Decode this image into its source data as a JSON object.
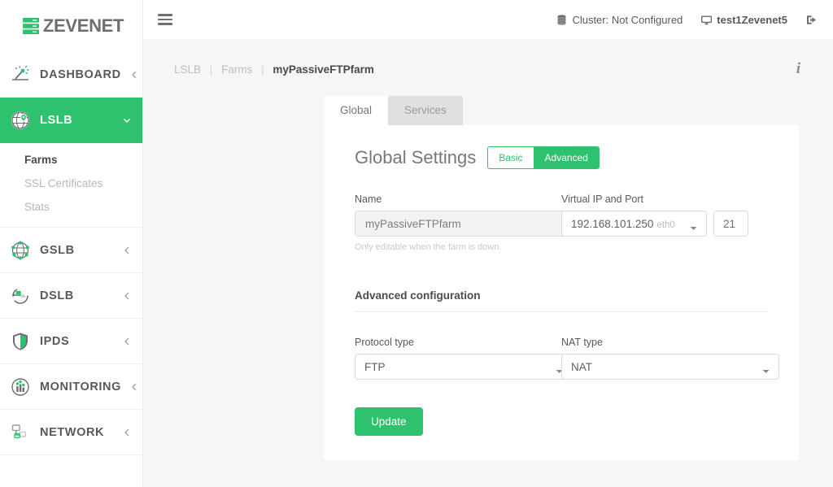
{
  "brand": {
    "name": "ZEVENET",
    "icon": "server-stack-icon"
  },
  "sidebar": {
    "items": [
      {
        "label": "DASHBOARD",
        "icon": "dashboard-gauge-icon",
        "chevron": "chevron-left-icon",
        "active": false
      },
      {
        "label": "LSLB",
        "icon": "globe-pin-icon",
        "chevron": "chevron-down-icon",
        "active": true
      },
      {
        "label": "GSLB",
        "icon": "globe-nodes-icon",
        "chevron": "chevron-left-icon",
        "active": false
      },
      {
        "label": "DSLB",
        "icon": "datalink-cycle-icon",
        "chevron": "chevron-left-icon",
        "active": false
      },
      {
        "label": "IPDS",
        "icon": "shield-icon",
        "chevron": "chevron-left-icon",
        "active": false
      },
      {
        "label": "MONITORING",
        "icon": "monitoring-chart-icon",
        "chevron": "chevron-left-icon",
        "active": false
      },
      {
        "label": "NETWORK",
        "icon": "network-nodes-icon",
        "chevron": "chevron-left-icon",
        "active": false
      }
    ],
    "lslb_subitems": [
      {
        "label": "Farms",
        "active": true
      },
      {
        "label": "SSL Certificates",
        "active": false
      },
      {
        "label": "Stats",
        "active": false
      }
    ]
  },
  "topbar": {
    "menu_icon": "hamburger-icon",
    "cluster": {
      "label": "Cluster: Not Configured",
      "icon": "database-stack-icon"
    },
    "user": {
      "label": "test1Zevenet5",
      "icon": "monitor-icon"
    },
    "logout": {
      "icon": "sign-out-icon",
      "label": ""
    }
  },
  "breadcrumb": {
    "items": [
      "LSLB",
      "Farms",
      "myPassiveFTPfarm"
    ],
    "separator": "|",
    "info_icon": "info-icon",
    "info_glyph": "i"
  },
  "tabs": [
    {
      "label": "Global",
      "active": true
    },
    {
      "label": "Services",
      "active": false
    }
  ],
  "panel": {
    "title": "Global Settings",
    "mode_toggle": [
      {
        "label": "Basic",
        "active": false
      },
      {
        "label": "Advanced",
        "active": true
      }
    ],
    "fields": {
      "name": {
        "label": "Name",
        "value": "myPassiveFTPfarm",
        "helper": "Only editable when the farm is down."
      },
      "virtual_ip": {
        "label": "Virtual IP and Port",
        "value": "192.168.101.250",
        "interface": "eth0",
        "port": "21"
      }
    },
    "advanced": {
      "title": "Advanced configuration",
      "protocol_type": {
        "label": "Protocol type",
        "value": "FTP"
      },
      "nat_type": {
        "label": "NAT type",
        "value": "NAT"
      }
    },
    "update_button": "Update"
  },
  "colors": {
    "accent_green": "#2ec26f",
    "sidebar_bg": "#ffffff",
    "content_bg": "#f6f6f6",
    "text_gray": "#58595b",
    "muted_gray": "#b6b7b9"
  }
}
